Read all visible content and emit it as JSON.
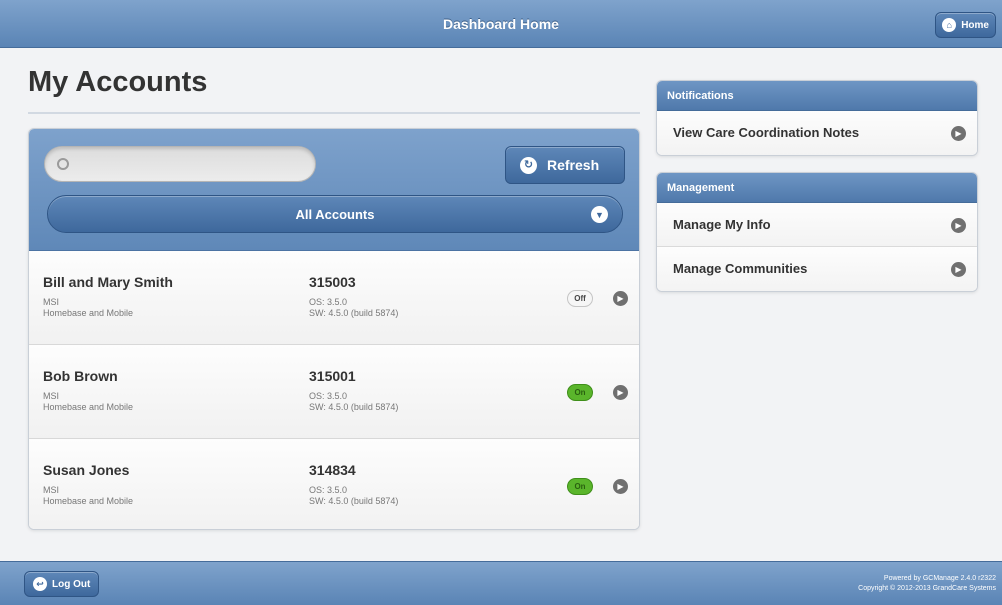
{
  "header": {
    "title": "Dashboard Home",
    "home_label": "Home"
  },
  "page": {
    "title": "My Accounts"
  },
  "search": {
    "placeholder": "",
    "value": ""
  },
  "toolbar": {
    "refresh_label": "Refresh"
  },
  "filter": {
    "selected": "All Accounts"
  },
  "accounts": [
    {
      "name": "Bill and Mary Smith",
      "line1": "MSI",
      "line2": "Homebase and Mobile",
      "id": "315003",
      "os": "OS: 3.5.0",
      "sw": "SW: 4.5.0 (build 5874)",
      "status": "Off"
    },
    {
      "name": "Bob Brown",
      "line1": "MSI",
      "line2": "Homebase and Mobile",
      "id": "315001",
      "os": "OS: 3.5.0",
      "sw": "SW: 4.5.0 (build 5874)",
      "status": "On"
    },
    {
      "name": "Susan Jones",
      "line1": "MSI",
      "line2": "Homebase and Mobile",
      "id": "314834",
      "os": "OS: 3.5.0",
      "sw": "SW: 4.5.0 (build 5874)",
      "status": "On"
    }
  ],
  "notifications": {
    "title": "Notifications",
    "items": [
      "View Care Coordination Notes"
    ]
  },
  "management": {
    "title": "Management",
    "items": [
      "Manage My Info",
      "Manage Communities"
    ]
  },
  "footer": {
    "logout_label": "Log Out",
    "powered_by": "Powered by GCManage 2.4.0 r2322",
    "copyright": "Copyright © 2012-2013 GrandCare Systems"
  },
  "colors": {
    "header": "#6a92c2",
    "toggle_on": "#5ab52b",
    "accent": "#3e689c"
  }
}
